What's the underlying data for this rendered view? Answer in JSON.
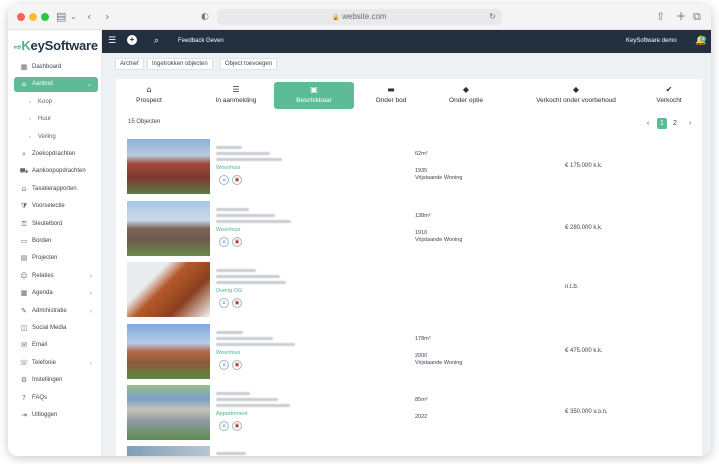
{
  "browser": {
    "url": "website.com"
  },
  "app": {
    "logo_prefix": "K",
    "logo_text": "eySoftware",
    "user_name": "KeySoftware demo",
    "notification_count": "0"
  },
  "topbar": {
    "feedback": "Feedback Geven"
  },
  "sidebar": {
    "items": [
      {
        "label": "Dashboard",
        "icon": "dashboard-icon"
      },
      {
        "label": "Aanbod",
        "icon": "home-icon",
        "active": true
      },
      {
        "label": "Koop",
        "icon": "dot-icon"
      },
      {
        "label": "Huur",
        "icon": "dot-icon"
      },
      {
        "label": "Veiling",
        "icon": "dot-icon"
      },
      {
        "label": "Zoekopdrachten",
        "icon": "search-icon"
      },
      {
        "label": "Aankoopopdrachten",
        "icon": "cart-icon"
      },
      {
        "label": "Taxatierapporten",
        "icon": "house-icon"
      },
      {
        "label": "Voorselectie",
        "icon": "filter-icon"
      },
      {
        "label": "Sleutelbord",
        "icon": "key-icon"
      },
      {
        "label": "Borden",
        "icon": "board-icon"
      },
      {
        "label": "Projecten",
        "icon": "project-icon"
      },
      {
        "label": "Relaties",
        "icon": "users-icon"
      },
      {
        "label": "Agenda",
        "icon": "calendar-icon"
      },
      {
        "label": "Administratie",
        "icon": "admin-icon"
      },
      {
        "label": "Social Media",
        "icon": "social-icon"
      },
      {
        "label": "Email",
        "icon": "mail-icon"
      },
      {
        "label": "Telefonie",
        "icon": "phone-icon"
      },
      {
        "label": "Instellingen",
        "icon": "gear-icon"
      },
      {
        "label": "FAQs",
        "icon": "question-icon"
      },
      {
        "label": "Uitloggen",
        "icon": "logout-icon"
      }
    ]
  },
  "subtabs": [
    "Archief",
    "Ingetrokken objecten",
    "Object toevoegen"
  ],
  "status_tabs": [
    {
      "label": "Prospect",
      "icon": "home-icon"
    },
    {
      "label": "In aanmelding",
      "icon": "list-icon"
    },
    {
      "label": "Beschikbaar",
      "icon": "calendar-check-icon",
      "active": true
    },
    {
      "label": "Onder bod",
      "icon": "money-icon"
    },
    {
      "label": "Onder optie",
      "icon": "tag-icon"
    },
    {
      "label": "Verkocht onder voorbehoud",
      "icon": "tag-icon"
    },
    {
      "label": "Verkocht",
      "icon": "check-circle-icon"
    }
  ],
  "listing": {
    "count": "15 Objecten",
    "pages": [
      "1",
      "2"
    ],
    "current_page": "1"
  },
  "objects": [
    {
      "type": "Woonhuis",
      "area": "62m²",
      "year": "1935",
      "kind": "Vrijstaande Woning",
      "price": "€ 175.000 k.k."
    },
    {
      "type": "Woonhuis",
      "area": "138m²",
      "year": "1910",
      "kind": "Vrijstaande Woning",
      "price": "€ 280.000 k.k."
    },
    {
      "type": "Overig OG",
      "area": "",
      "year": "",
      "kind": "",
      "price": "n.t.b."
    },
    {
      "type": "Woonhuis",
      "area": "178m²",
      "year": "2000",
      "kind": "Vrijstaande Woning",
      "price": "€ 475.000 k.k."
    },
    {
      "type": "Appartement",
      "area": "85m²",
      "year": "2022",
      "kind": "",
      "price": "€ 350.000 v.o.n."
    }
  ],
  "colors": {
    "accent": "#5dbb96",
    "nav": "#233040",
    "background": "#eef1f4"
  }
}
